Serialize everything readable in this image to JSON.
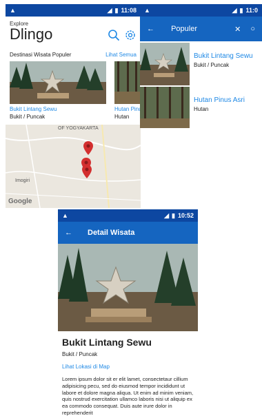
{
  "home": {
    "status": {
      "time": "11:08"
    },
    "explore": "Explore",
    "brand": "Dlingo",
    "section_title": "Destinasi Wisata Populer",
    "see_all": "Lihat Semua",
    "cards": [
      {
        "name": "Bukit Lintang Sewu",
        "location": "Bukit / Puncak"
      },
      {
        "name": "Hutan Pinus",
        "location": "Hutan"
      }
    ],
    "map": {
      "label_city": "OF YOGYAKARTA",
      "label_town": "Imogiri",
      "logo": "Google"
    }
  },
  "popular": {
    "status": {
      "time": "11:0"
    },
    "title": "Populer",
    "items": [
      {
        "name": "Bukit Lintang Sewu",
        "location": "Bukit / Puncak"
      },
      {
        "name": "Hutan Pinus Asri",
        "location": "Hutan"
      }
    ]
  },
  "detail": {
    "status": {
      "time": "10:52"
    },
    "title": "Detail Wisata",
    "place_name": "Bukit Lintang Sewu",
    "location": "Bukit / Puncak",
    "map_link": "Lihat Lokasi di Map",
    "description": "Lorem ipsum dolor sit er elit lamet, consectetaur cillium adipisicing pecu, sed do eiusmod tempor incididunt ut labore et dolore magna aliqua. Ut enim ad minim veniam, quis nostrud exercitation ullamco laboris nisi ut aliquip ex ea commodo consequat. Duis aute irure dolor in reprehenderit"
  },
  "colors": {
    "statusbar": "#0d47a1",
    "appbar": "#1565c0",
    "link": "#1e88e5",
    "marker": "#d32f2f"
  }
}
